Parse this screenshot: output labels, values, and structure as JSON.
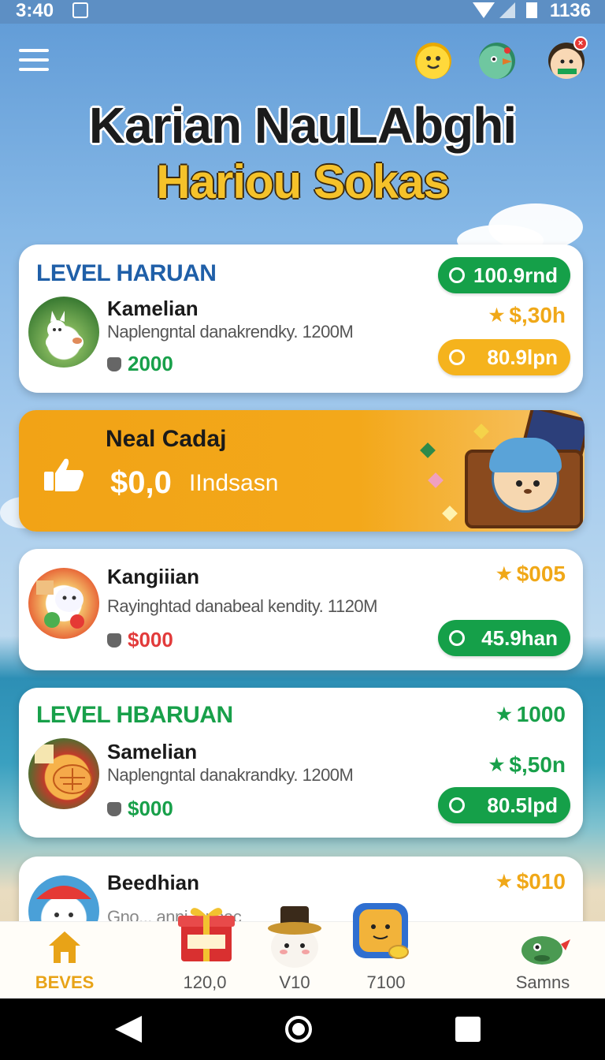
{
  "status_bar": {
    "time": "3:40",
    "right_text": "1136"
  },
  "header": {
    "title_line1": "Karian NauLAbghi",
    "title_line2": "Hariou Sokas",
    "icons": [
      "menu-icon",
      "emoji-face-icon",
      "bird-icon",
      "profile-avatar-icon"
    ],
    "notification_badge": "×"
  },
  "cards": [
    {
      "level": "LEVEL HARUAN",
      "name": "Kamelian",
      "desc": "Naplengntal danakrendky. 1200M",
      "value": "2000",
      "top_pill": "100.9rnd",
      "star_value": "$,30h",
      "bottom_pill": "80.9lpn"
    },
    {
      "name": "Kangiiian",
      "desc": "Rayinghtad danabeal kendity. 1120M",
      "value": "$000",
      "star_value": "$005",
      "bottom_pill": "45.9han"
    },
    {
      "level": "LEVEL HBARUAN",
      "name": "Samelian",
      "desc": "Naplengntal danakrandky. 1200M",
      "value": "$000",
      "star_top": "1000",
      "star_value": "$,50n",
      "bottom_pill": "80.5lpd"
    },
    {
      "name": "Beedhian",
      "desc": "Gno... anni... nnac",
      "star_value": "$010"
    }
  ],
  "promo": {
    "title": "Neal Cadaj",
    "amount": "$0,0",
    "subtitle": "IIndsasn"
  },
  "bottom_nav": [
    {
      "label": "BEVES",
      "icon": "home-icon",
      "active": true
    },
    {
      "label": "120,0",
      "icon": "gift-box-icon"
    },
    {
      "label": "V10",
      "icon": "mascot-hat-icon"
    },
    {
      "label": "7100",
      "icon": "cat-coin-icon"
    },
    {
      "label": "Samns",
      "icon": "bird-mascot-icon"
    }
  ],
  "colors": {
    "accent_green": "#15a049",
    "accent_gold": "#f5b31d",
    "level_blue": "#1f5fa8",
    "level_green": "#18a04a",
    "value_red": "#e23b3b",
    "promo_orange": "#f2a316"
  }
}
